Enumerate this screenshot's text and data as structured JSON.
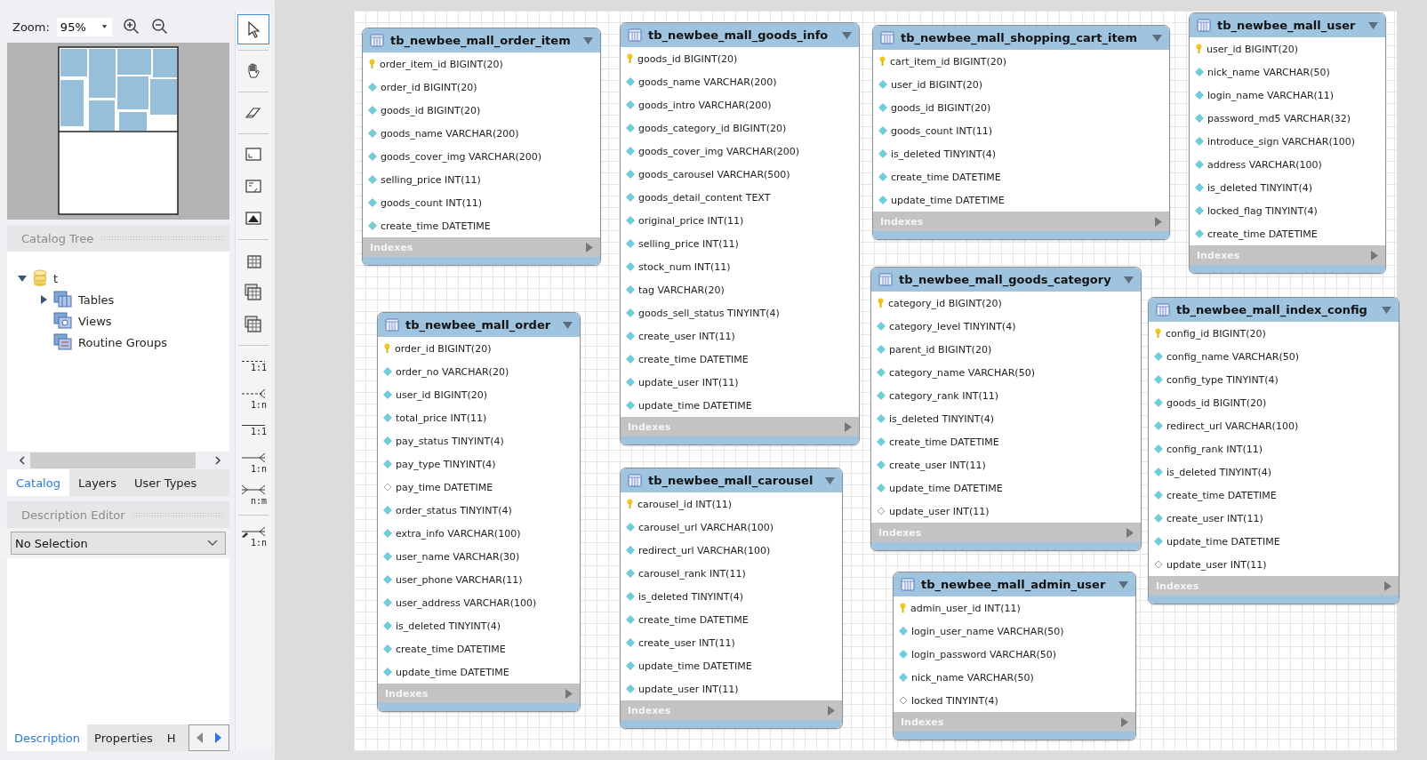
{
  "birds_eye": {
    "zoom_label": "Zoom:",
    "zoom_value": "95%"
  },
  "catalog_tree": {
    "title": "Catalog Tree",
    "items": [
      {
        "label": "t",
        "expanded": true,
        "children": [
          {
            "label": "Tables",
            "kind": "tables",
            "expanded": false
          },
          {
            "label": "Views",
            "kind": "views"
          },
          {
            "label": "Routine Groups",
            "kind": "routines"
          }
        ]
      }
    ]
  },
  "catalog_tabs": [
    {
      "label": "Catalog",
      "selected": true
    },
    {
      "label": "Layers",
      "selected": false
    },
    {
      "label": "User Types",
      "selected": false
    }
  ],
  "description_editor": {
    "title": "Description Editor",
    "selection": "No Selection"
  },
  "bottom_tabs": [
    {
      "label": "Description",
      "selected": true
    },
    {
      "label": "Properties",
      "selected": false
    },
    {
      "label": "H",
      "selected": false
    }
  ],
  "toolbar": [
    {
      "kind": "select",
      "selected": true
    },
    {
      "kind": "hand",
      "selected": false
    },
    {
      "kind": "eraser",
      "selected": false
    },
    {
      "kind": "layer",
      "selected": false
    },
    {
      "kind": "note",
      "selected": false
    },
    {
      "kind": "image",
      "selected": false
    },
    {
      "kind": "table",
      "selected": false
    },
    {
      "kind": "view",
      "selected": false
    },
    {
      "kind": "routine",
      "selected": false
    },
    {
      "kind": "rel-dashed-one",
      "label": "1:1",
      "selected": false
    },
    {
      "kind": "rel-dashed-many",
      "label": "1:n",
      "selected": false
    },
    {
      "kind": "rel-one",
      "label": "1:1",
      "selected": false
    },
    {
      "kind": "rel-many",
      "label": "1:n",
      "selected": false
    },
    {
      "kind": "rel-many-many",
      "label": "n:m",
      "selected": false
    },
    {
      "kind": "rel-pick",
      "label": "1:n",
      "selected": false
    }
  ],
  "tables": [
    {
      "name": "tb_newbee_mall_order_item",
      "indexes_label": "Indexes",
      "columns": [
        {
          "kind": "pk",
          "text": "order_item_id BIGINT(20)"
        },
        {
          "kind": "notnull",
          "text": "order_id BIGINT(20)"
        },
        {
          "kind": "notnull",
          "text": "goods_id BIGINT(20)"
        },
        {
          "kind": "notnull",
          "text": "goods_name VARCHAR(200)"
        },
        {
          "kind": "notnull",
          "text": "goods_cover_img VARCHAR(200)"
        },
        {
          "kind": "notnull",
          "text": "selling_price INT(11)"
        },
        {
          "kind": "notnull",
          "text": "goods_count INT(11)"
        },
        {
          "kind": "notnull",
          "text": "create_time DATETIME"
        }
      ]
    },
    {
      "name": "tb_newbee_mall_goods_info",
      "indexes_label": "Indexes",
      "columns": [
        {
          "kind": "pk",
          "text": "goods_id BIGINT(20)"
        },
        {
          "kind": "notnull",
          "text": "goods_name VARCHAR(200)"
        },
        {
          "kind": "notnull",
          "text": "goods_intro VARCHAR(200)"
        },
        {
          "kind": "notnull",
          "text": "goods_category_id BIGINT(20)"
        },
        {
          "kind": "notnull",
          "text": "goods_cover_img VARCHAR(200)"
        },
        {
          "kind": "notnull",
          "text": "goods_carousel VARCHAR(500)"
        },
        {
          "kind": "notnull",
          "text": "goods_detail_content TEXT"
        },
        {
          "kind": "notnull",
          "text": "original_price INT(11)"
        },
        {
          "kind": "notnull",
          "text": "selling_price INT(11)"
        },
        {
          "kind": "notnull",
          "text": "stock_num INT(11)"
        },
        {
          "kind": "notnull",
          "text": "tag VARCHAR(20)"
        },
        {
          "kind": "notnull",
          "text": "goods_sell_status TINYINT(4)"
        },
        {
          "kind": "notnull",
          "text": "create_user INT(11)"
        },
        {
          "kind": "notnull",
          "text": "create_time DATETIME"
        },
        {
          "kind": "notnull",
          "text": "update_user INT(11)"
        },
        {
          "kind": "notnull",
          "text": "update_time DATETIME"
        }
      ]
    },
    {
      "name": "tb_newbee_mall_shopping_cart_item",
      "indexes_label": "Indexes",
      "columns": [
        {
          "kind": "pk",
          "text": "cart_item_id BIGINT(20)"
        },
        {
          "kind": "notnull",
          "text": "user_id BIGINT(20)"
        },
        {
          "kind": "notnull",
          "text": "goods_id BIGINT(20)"
        },
        {
          "kind": "notnull",
          "text": "goods_count INT(11)"
        },
        {
          "kind": "notnull",
          "text": "is_deleted TINYINT(4)"
        },
        {
          "kind": "notnull",
          "text": "create_time DATETIME"
        },
        {
          "kind": "notnull",
          "text": "update_time DATETIME"
        }
      ]
    },
    {
      "name": "tb_newbee_mall_user",
      "indexes_label": "Indexes",
      "columns": [
        {
          "kind": "pk",
          "text": "user_id BIGINT(20)"
        },
        {
          "kind": "notnull",
          "text": "nick_name VARCHAR(50)"
        },
        {
          "kind": "notnull",
          "text": "login_name VARCHAR(11)"
        },
        {
          "kind": "notnull",
          "text": "password_md5 VARCHAR(32)"
        },
        {
          "kind": "notnull",
          "text": "introduce_sign VARCHAR(100)"
        },
        {
          "kind": "notnull",
          "text": "address VARCHAR(100)"
        },
        {
          "kind": "notnull",
          "text": "is_deleted TINYINT(4)"
        },
        {
          "kind": "notnull",
          "text": "locked_flag TINYINT(4)"
        },
        {
          "kind": "notnull",
          "text": "create_time DATETIME"
        }
      ]
    },
    {
      "name": "tb_newbee_mall_order",
      "indexes_label": "Indexes",
      "columns": [
        {
          "kind": "pk",
          "text": "order_id BIGINT(20)"
        },
        {
          "kind": "notnull",
          "text": "order_no VARCHAR(20)"
        },
        {
          "kind": "notnull",
          "text": "user_id BIGINT(20)"
        },
        {
          "kind": "notnull",
          "text": "total_price INT(11)"
        },
        {
          "kind": "notnull",
          "text": "pay_status TINYINT(4)"
        },
        {
          "kind": "notnull",
          "text": "pay_type TINYINT(4)"
        },
        {
          "kind": "nullable",
          "text": "pay_time DATETIME"
        },
        {
          "kind": "notnull",
          "text": "order_status TINYINT(4)"
        },
        {
          "kind": "notnull",
          "text": "extra_info VARCHAR(100)"
        },
        {
          "kind": "notnull",
          "text": "user_name VARCHAR(30)"
        },
        {
          "kind": "notnull",
          "text": "user_phone VARCHAR(11)"
        },
        {
          "kind": "notnull",
          "text": "user_address VARCHAR(100)"
        },
        {
          "kind": "notnull",
          "text": "is_deleted TINYINT(4)"
        },
        {
          "kind": "notnull",
          "text": "create_time DATETIME"
        },
        {
          "kind": "notnull",
          "text": "update_time DATETIME"
        }
      ]
    },
    {
      "name": "tb_newbee_mall_carousel",
      "indexes_label": "Indexes",
      "columns": [
        {
          "kind": "pk",
          "text": "carousel_id INT(11)"
        },
        {
          "kind": "notnull",
          "text": "carousel_url VARCHAR(100)"
        },
        {
          "kind": "notnull",
          "text": "redirect_url VARCHAR(100)"
        },
        {
          "kind": "notnull",
          "text": "carousel_rank INT(11)"
        },
        {
          "kind": "notnull",
          "text": "is_deleted TINYINT(4)"
        },
        {
          "kind": "notnull",
          "text": "create_time DATETIME"
        },
        {
          "kind": "notnull",
          "text": "create_user INT(11)"
        },
        {
          "kind": "notnull",
          "text": "update_time DATETIME"
        },
        {
          "kind": "notnull",
          "text": "update_user INT(11)"
        }
      ]
    },
    {
      "name": "tb_newbee_mall_goods_category",
      "indexes_label": "Indexes",
      "columns": [
        {
          "kind": "pk",
          "text": "category_id BIGINT(20)"
        },
        {
          "kind": "notnull",
          "text": "category_level TINYINT(4)"
        },
        {
          "kind": "notnull",
          "text": "parent_id BIGINT(20)"
        },
        {
          "kind": "notnull",
          "text": "category_name VARCHAR(50)"
        },
        {
          "kind": "notnull",
          "text": "category_rank INT(11)"
        },
        {
          "kind": "notnull",
          "text": "is_deleted TINYINT(4)"
        },
        {
          "kind": "notnull",
          "text": "create_time DATETIME"
        },
        {
          "kind": "notnull",
          "text": "create_user INT(11)"
        },
        {
          "kind": "notnull",
          "text": "update_time DATETIME"
        },
        {
          "kind": "nullable",
          "text": "update_user INT(11)"
        }
      ]
    },
    {
      "name": "tb_newbee_mall_index_config",
      "indexes_label": "Indexes",
      "columns": [
        {
          "kind": "pk",
          "text": "config_id BIGINT(20)"
        },
        {
          "kind": "notnull",
          "text": "config_name VARCHAR(50)"
        },
        {
          "kind": "notnull",
          "text": "config_type TINYINT(4)"
        },
        {
          "kind": "notnull",
          "text": "goods_id BIGINT(20)"
        },
        {
          "kind": "notnull",
          "text": "redirect_url VARCHAR(100)"
        },
        {
          "kind": "notnull",
          "text": "config_rank INT(11)"
        },
        {
          "kind": "notnull",
          "text": "is_deleted TINYINT(4)"
        },
        {
          "kind": "notnull",
          "text": "create_time DATETIME"
        },
        {
          "kind": "notnull",
          "text": "create_user INT(11)"
        },
        {
          "kind": "notnull",
          "text": "update_time DATETIME"
        },
        {
          "kind": "nullable",
          "text": "update_user INT(11)"
        }
      ]
    },
    {
      "name": "tb_newbee_mall_admin_user",
      "indexes_label": "Indexes",
      "columns": [
        {
          "kind": "pk",
          "text": "admin_user_id INT(11)"
        },
        {
          "kind": "notnull",
          "text": "login_user_name VARCHAR(50)"
        },
        {
          "kind": "notnull",
          "text": "login_password VARCHAR(50)"
        },
        {
          "kind": "notnull",
          "text": "nick_name VARCHAR(50)"
        },
        {
          "kind": "nullable",
          "text": "locked TINYINT(4)"
        }
      ]
    }
  ]
}
